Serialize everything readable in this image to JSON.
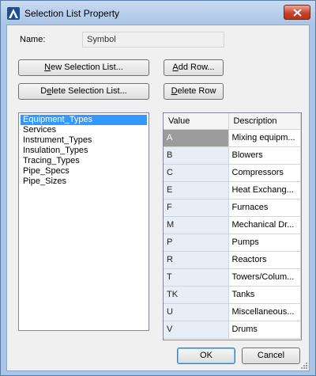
{
  "window": {
    "title": "Selection List Property",
    "close_symbol": "close-icon"
  },
  "name_label": "Name:",
  "name_value": "Symbol",
  "buttons": {
    "new_list": {
      "prefix": "",
      "accel": "N",
      "rest": "ew Selection List..."
    },
    "delete_list": {
      "prefix": "D",
      "accel": "e",
      "rest": "lete Selection List..."
    },
    "add_row": {
      "prefix": "",
      "accel": "A",
      "rest": "dd Row..."
    },
    "delete_row": {
      "prefix": "",
      "accel": "D",
      "rest": "elete Row"
    },
    "ok": "OK",
    "cancel": "Cancel"
  },
  "lists": [
    {
      "label": "Equipment_Types",
      "selected": true
    },
    {
      "label": "Services",
      "selected": false
    },
    {
      "label": "Instrument_Types",
      "selected": false
    },
    {
      "label": "Insulation_Types",
      "selected": false
    },
    {
      "label": "Tracing_Types",
      "selected": false
    },
    {
      "label": "Pipe_Specs",
      "selected": false
    },
    {
      "label": "Pipe_Sizes",
      "selected": false
    }
  ],
  "grid": {
    "headers": [
      "Value",
      "Description"
    ],
    "rows": [
      {
        "value": "A",
        "description": "Mixing equipm...",
        "selected": true
      },
      {
        "value": "B",
        "description": "Blowers",
        "selected": false
      },
      {
        "value": "C",
        "description": "Compressors",
        "selected": false
      },
      {
        "value": "E",
        "description": "Heat Exchang...",
        "selected": false
      },
      {
        "value": "F",
        "description": "Furnaces",
        "selected": false
      },
      {
        "value": "M",
        "description": "Mechanical Dr...",
        "selected": false
      },
      {
        "value": "P",
        "description": "Pumps",
        "selected": false
      },
      {
        "value": "R",
        "description": "Reactors",
        "selected": false
      },
      {
        "value": "T",
        "description": "Towers/Colum...",
        "selected": false
      },
      {
        "value": "TK",
        "description": "Tanks",
        "selected": false
      },
      {
        "value": "U",
        "description": "Miscellaneous...",
        "selected": false
      },
      {
        "value": "V",
        "description": "Drums",
        "selected": false
      }
    ]
  }
}
